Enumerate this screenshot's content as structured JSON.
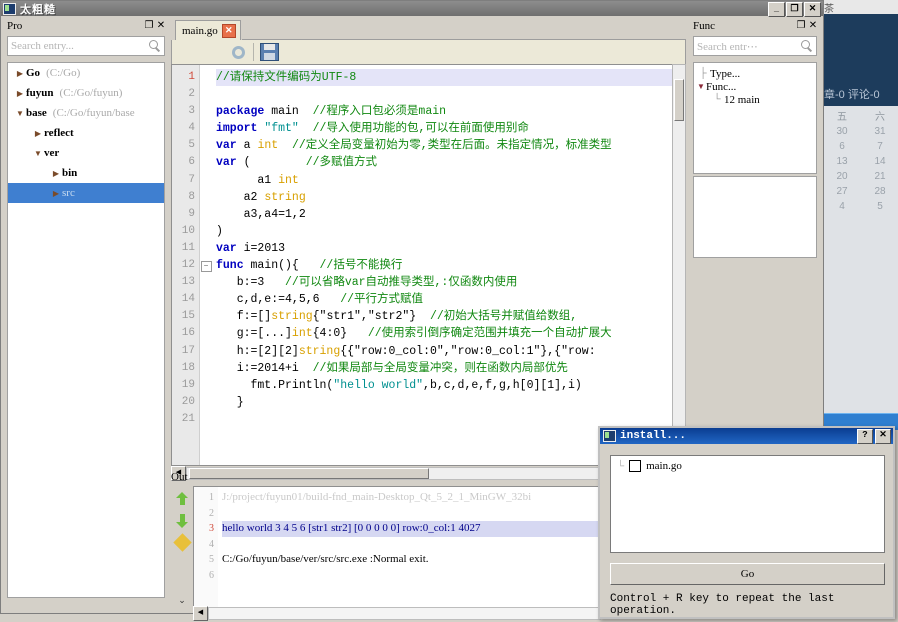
{
  "window": {
    "title": "太粗糙",
    "icon": "app-icon",
    "controls": [
      {
        "name": "minimize",
        "glyph": "_"
      },
      {
        "name": "maximize",
        "glyph": "❐"
      },
      {
        "name": "close",
        "glyph": "✕"
      }
    ]
  },
  "background": {
    "strip_text": "茶",
    "blue_panel_label": "章-0 评论-0",
    "calendar": {
      "headers": [
        "五",
        "六"
      ],
      "rows": [
        [
          "30",
          "31"
        ],
        [
          "6",
          "7"
        ],
        [
          "13",
          "14"
        ],
        [
          "20",
          "21"
        ],
        [
          "27",
          "28"
        ],
        [
          "4",
          "5"
        ]
      ]
    }
  },
  "project_panel": {
    "title": "Pro",
    "float_glyph": "❐",
    "close_glyph": "✕",
    "search": {
      "placeholder": "Search entry...",
      "value": "",
      "icon": "search-icon"
    },
    "tree": [
      {
        "label": "Go",
        "path": "(C:/Go)",
        "indent": 0,
        "expanded": false,
        "selected": false
      },
      {
        "label": "fuyun",
        "path": "(C:/Go/fuyun)",
        "indent": 0,
        "expanded": false,
        "selected": false
      },
      {
        "label": "base",
        "path": "(C:/Go/fuyun/base",
        "indent": 0,
        "expanded": true,
        "selected": false
      },
      {
        "label": "reflect",
        "path": "",
        "indent": 1,
        "expanded": false,
        "selected": false
      },
      {
        "label": "ver",
        "path": "",
        "indent": 1,
        "expanded": true,
        "selected": false
      },
      {
        "label": "bin",
        "path": "",
        "indent": 2,
        "expanded": false,
        "selected": false
      },
      {
        "label": "src",
        "path": "",
        "indent": 2,
        "expanded": false,
        "selected": true
      }
    ]
  },
  "editor": {
    "tab": {
      "label": "main.go",
      "close_glyph": "✕"
    },
    "toolbar": [
      {
        "name": "gear-icon",
        "label": "settings"
      },
      {
        "name": "save-icon",
        "label": "save"
      }
    ],
    "line_numbers": [
      "1",
      "2",
      "3",
      "4",
      "5",
      "6",
      "7",
      "8",
      "9",
      "10",
      "11",
      "12",
      "13",
      "14",
      "15",
      "16",
      "17",
      "18",
      "19",
      "20",
      "21"
    ],
    "fold_marker_line": 12,
    "fold_glyph": "−",
    "lines": [
      {
        "n": 1,
        "highlight": true,
        "tokens": [
          {
            "t": "cm",
            "v": "//请保持文件编码为UTF-8"
          }
        ]
      },
      {
        "n": 2,
        "tokens": []
      },
      {
        "n": 3,
        "tokens": [
          {
            "t": "kw",
            "v": "package"
          },
          {
            "t": "pl",
            "v": " main  "
          },
          {
            "t": "cm",
            "v": "//程序入口包必须是main"
          }
        ]
      },
      {
        "n": 4,
        "tokens": [
          {
            "t": "kw",
            "v": "import"
          },
          {
            "t": "pl",
            "v": " "
          },
          {
            "t": "st",
            "v": "\"fmt\""
          },
          {
            "t": "pl",
            "v": "  "
          },
          {
            "t": "cm",
            "v": "//导入使用功能的包,可以在前面使用别命"
          }
        ]
      },
      {
        "n": 5,
        "tokens": [
          {
            "t": "kw",
            "v": "var"
          },
          {
            "t": "pl",
            "v": " a "
          },
          {
            "t": "ty",
            "v": "int"
          },
          {
            "t": "pl",
            "v": "  "
          },
          {
            "t": "cm",
            "v": "//定义全局变量初始为零,类型在后面。未指定情况，标准类型"
          }
        ]
      },
      {
        "n": 6,
        "tokens": [
          {
            "t": "kw",
            "v": "var"
          },
          {
            "t": "pl",
            "v": " (        "
          },
          {
            "t": "cm",
            "v": "//多赋值方式"
          }
        ]
      },
      {
        "n": 7,
        "tokens": [
          {
            "t": "pl",
            "v": "      a1 "
          },
          {
            "t": "ty",
            "v": "int"
          }
        ]
      },
      {
        "n": 8,
        "tokens": [
          {
            "t": "pl",
            "v": "    a2 "
          },
          {
            "t": "ty",
            "v": "string"
          }
        ]
      },
      {
        "n": 9,
        "tokens": [
          {
            "t": "pl",
            "v": "    a3,a4=1,2"
          }
        ]
      },
      {
        "n": 10,
        "tokens": [
          {
            "t": "pl",
            "v": ")"
          }
        ]
      },
      {
        "n": 11,
        "tokens": [
          {
            "t": "kw",
            "v": "var"
          },
          {
            "t": "pl",
            "v": " i=2013"
          }
        ]
      },
      {
        "n": 12,
        "tokens": [
          {
            "t": "kw",
            "v": "func"
          },
          {
            "t": "pl",
            "v": " main(){   "
          },
          {
            "t": "cm",
            "v": "//括号不能换行"
          }
        ]
      },
      {
        "n": 13,
        "tokens": [
          {
            "t": "pl",
            "v": "   b:=3   "
          },
          {
            "t": "cm",
            "v": "//可以省略var自动推导类型,:仅函数内使用"
          }
        ]
      },
      {
        "n": 14,
        "tokens": [
          {
            "t": "pl",
            "v": "   c,d,e:=4,5,6   "
          },
          {
            "t": "cm",
            "v": "//平行方式赋值"
          }
        ]
      },
      {
        "n": 15,
        "tokens": [
          {
            "t": "pl",
            "v": "   f:=[]"
          },
          {
            "t": "ty",
            "v": "string"
          },
          {
            "t": "pl",
            "v": "{\"str1\",\"str2\"}  "
          },
          {
            "t": "cm",
            "v": "//初始大括号并赋值给数组,"
          }
        ]
      },
      {
        "n": 16,
        "tokens": [
          {
            "t": "pl",
            "v": "   g:=[...]"
          },
          {
            "t": "ty",
            "v": "int"
          },
          {
            "t": "pl",
            "v": "{4:0}   "
          },
          {
            "t": "cm",
            "v": "//使用索引倒序确定范围并填充一个自动扩展大"
          }
        ]
      },
      {
        "n": 17,
        "tokens": [
          {
            "t": "pl",
            "v": "   h:=[2][2]"
          },
          {
            "t": "ty",
            "v": "string"
          },
          {
            "t": "pl",
            "v": "{{\"row:0_col:0\",\"row:0_col:1\"},{\"row:"
          }
        ]
      },
      {
        "n": 18,
        "tokens": [
          {
            "t": "pl",
            "v": "   i:=2014+i  "
          },
          {
            "t": "cm",
            "v": "//如果局部与全局变量冲突，则在函数内局部优先"
          }
        ]
      },
      {
        "n": 19,
        "tokens": [
          {
            "t": "pl",
            "v": "     fmt.Println("
          },
          {
            "t": "st",
            "v": "\"hello world\""
          },
          {
            "t": "pl",
            "v": ",b,c,d,e,f,g,h[0][1],i)"
          }
        ]
      },
      {
        "n": 20,
        "tokens": [
          {
            "t": "pl",
            "v": "   }"
          }
        ]
      },
      {
        "n": 21,
        "tokens": []
      }
    ]
  },
  "output_panel": {
    "title": "Out",
    "icons": [
      {
        "name": "arrow-up-icon"
      },
      {
        "name": "arrow-down-icon"
      },
      {
        "name": "pencil-icon"
      },
      {
        "name": "chevron-double-down-icon",
        "glyph": "⌄"
      }
    ],
    "line_numbers": [
      "1",
      "2",
      "3",
      "4",
      "5",
      "6"
    ],
    "error_line": 3,
    "lines": [
      {
        "n": 1,
        "style": "dim",
        "text": "J:/project/fuyun01/build-fnd_main-Desktop_Qt_5_2_1_MinGW_32bi"
      },
      {
        "n": 2,
        "style": "plain",
        "text": ""
      },
      {
        "n": 3,
        "style": "sel",
        "text": "hello world 3 4 5 6 [str1 str2] [0 0 0 0 0] row:0_col:1 4027"
      },
      {
        "n": 4,
        "style": "plain",
        "text": ""
      },
      {
        "n": 5,
        "style": "plain",
        "text": "C:/Go/fuyun/base/ver/src/src.exe :Normal exit."
      },
      {
        "n": 6,
        "style": "plain",
        "text": ""
      }
    ]
  },
  "func_panel": {
    "title": "Func",
    "float_glyph": "❐",
    "close_glyph": "✕",
    "search": {
      "placeholder": "Search entr⋯",
      "value": "",
      "icon": "search-icon"
    },
    "tree": [
      {
        "label": "Type...",
        "indent": 0,
        "expanded": false
      },
      {
        "label": "Func...",
        "indent": 0,
        "expanded": true
      },
      {
        "label": "12 main",
        "indent": 1,
        "expanded": false
      }
    ]
  },
  "install_dialog": {
    "title": "install...",
    "icon": "app-icon",
    "help_glyph": "?",
    "close_glyph": "✕",
    "items": [
      {
        "label": "main.go",
        "checked": false
      }
    ],
    "go_button": "Go",
    "hint": "Control + R key to repeat the last operation."
  }
}
